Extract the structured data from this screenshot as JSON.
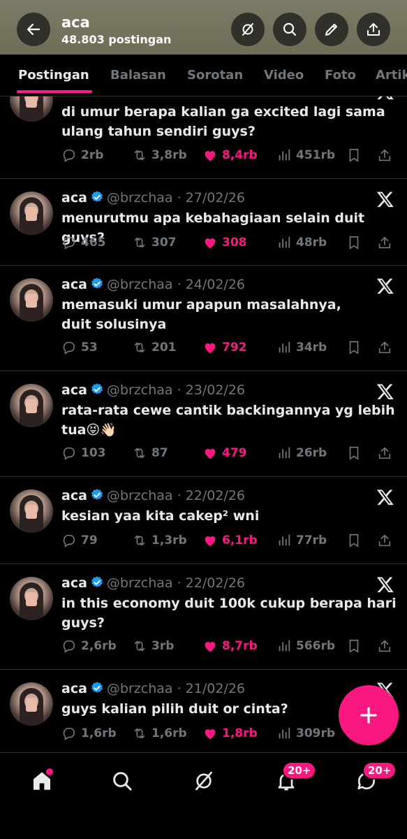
{
  "header": {
    "name": "aca",
    "post_count": "48.803 postingan"
  },
  "tabs": [
    {
      "label": "Postingan",
      "active": true
    },
    {
      "label": "Balasan",
      "active": false
    },
    {
      "label": "Sorotan",
      "active": false
    },
    {
      "label": "Video",
      "active": false
    },
    {
      "label": "Foto",
      "active": false
    },
    {
      "label": "Artik",
      "active": false
    }
  ],
  "posts": [
    {
      "name": "",
      "handle": "",
      "date": "",
      "text": "di umur berapa kalian ga excited lagi sama ulang tahun sendiri guys?",
      "replies": "2rb",
      "reposts": "3,8rb",
      "likes": "8,4rb",
      "views": "451rb"
    },
    {
      "name": "aca",
      "handle": "@brzchaa",
      "date": "27/02/26",
      "text": "menurutmu apa kebahagiaan selain duit guys?",
      "replies": "465",
      "reposts": "307",
      "likes": "308",
      "views": "48rb"
    },
    {
      "name": "aca",
      "handle": "@brzchaa",
      "date": "24/02/26",
      "text": "memasuki umur apapun masalahnya, duit solusinya",
      "replies": "53",
      "reposts": "201",
      "likes": "792",
      "views": "34rb"
    },
    {
      "name": "aca",
      "handle": "@brzchaa",
      "date": "23/02/26",
      "text": "rata-rata cewe cantik backingannya yg lebih tua😝👋🏻",
      "replies": "103",
      "reposts": "87",
      "likes": "479",
      "views": "26rb"
    },
    {
      "name": "aca",
      "handle": "@brzchaa",
      "date": "22/02/26",
      "text": "kesian yaa kita cakep² wni",
      "replies": "79",
      "reposts": "1,3rb",
      "likes": "6,1rb",
      "views": "77rb"
    },
    {
      "name": "aca",
      "handle": "@brzchaa",
      "date": "22/02/26",
      "text": "in this economy duit 100k cukup berapa hari guys?",
      "replies": "2,6rb",
      "reposts": "3rb",
      "likes": "8,7rb",
      "views": "566rb"
    },
    {
      "name": "aca",
      "handle": "@brzchaa",
      "date": "21/02/26",
      "text": "guys kalian pilih duit or cinta?",
      "replies": "1,6rb",
      "reposts": "1,6rb",
      "likes": "1,8rb",
      "views": "309rb"
    }
  ],
  "bottom_nav": {
    "notifications_badge": "20+",
    "messages_badge": "20+"
  },
  "colors": {
    "accent": "#f91880",
    "header_bg": "#7d7a66",
    "muted": "#71767b",
    "verified": "#1d9bf0"
  }
}
